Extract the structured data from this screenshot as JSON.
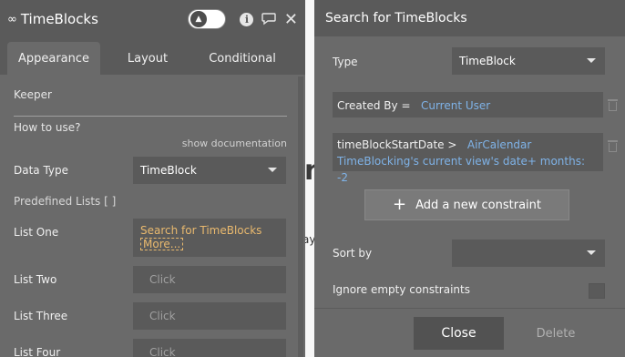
{
  "background": {
    "letter": "n",
    "fragment": "ay"
  },
  "left_panel": {
    "title": "TimeBlocks",
    "title_icon": "infinity-icon",
    "tabs": [
      {
        "label": "Appearance",
        "active": true
      },
      {
        "label": "Layout",
        "active": false
      },
      {
        "label": "Conditional",
        "active": false
      }
    ],
    "keeper_label": "Keeper",
    "how_to_use_label": "How to use?",
    "show_documentation": "show documentation",
    "data_type_label": "Data Type",
    "data_type_value": "TimeBlock",
    "predefined_lists_label": "Predefined Lists [ ]",
    "lists": [
      {
        "label": "List One",
        "value": "Search for TimeBlocks",
        "more": "More..."
      },
      {
        "label": "List Two",
        "value": "Click"
      },
      {
        "label": "List Three",
        "value": "Click"
      },
      {
        "label": "List Four",
        "value": "Click"
      }
    ]
  },
  "right_panel": {
    "title": "Search for TimeBlocks",
    "type_label": "Type",
    "type_value": "TimeBlock",
    "constraints": [
      {
        "key": "Created By =",
        "value": "Current User"
      },
      {
        "key": "timeBlockStartDate >",
        "value": "AirCalendar TimeBlocking's current view's date+ months: -2"
      }
    ],
    "add_constraint_label": "Add a new constraint",
    "sort_by_label": "Sort by",
    "sort_by_value": "",
    "ignore_empty_label": "Ignore empty constraints",
    "ignore_empty_checked": false,
    "close_label": "Close",
    "delete_label": "Delete"
  },
  "colors": {
    "panel_bg": "#6a6a6a",
    "header_bg": "#5a5a5a",
    "orange_link": "#e9b96e",
    "blue_value": "#7fb3e8"
  }
}
